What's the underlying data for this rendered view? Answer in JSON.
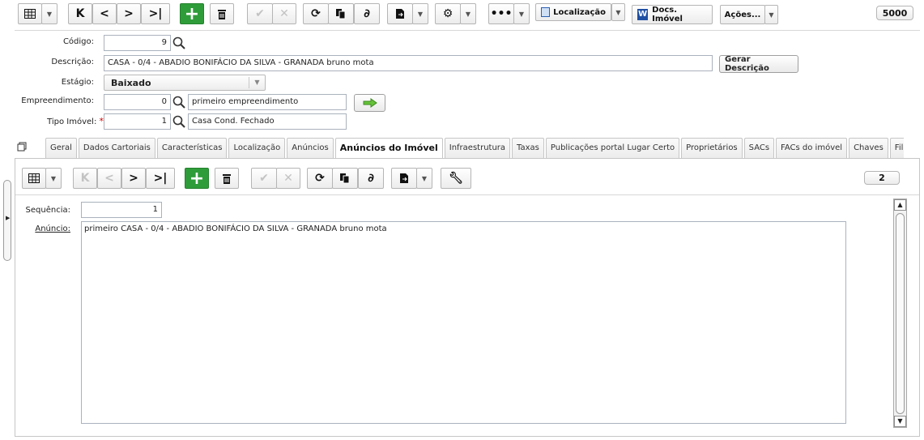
{
  "toolbar": {
    "localizacao_label": "Localização",
    "docs_label": "Docs. Imóvel",
    "acoes_label": "Ações...",
    "record_count": "5000"
  },
  "form": {
    "codigo_label": "Código:",
    "codigo_value": "9",
    "descricao_label": "Descrição:",
    "descricao_value": "CASA - 0/4 - ABADIO BONIFÁCIO DA SILVA - GRANADA bruno mota",
    "gerar_label": "Gerar Descrição",
    "estagio_label": "Estágio:",
    "estagio_value": "Baixado",
    "empreendimento_label": "Empreendimento:",
    "empreendimento_code": "0",
    "empreendimento_name": "primeiro empreendimento",
    "tipo_label": "Tipo Imóvel:",
    "tipo_required": "*",
    "tipo_code": "1",
    "tipo_name": "Casa Cond. Fechado"
  },
  "tabs": [
    {
      "label": "Geral"
    },
    {
      "label": "Dados Cartoriais"
    },
    {
      "label": "Características"
    },
    {
      "label": "Localização"
    },
    {
      "label": "Anúncios"
    },
    {
      "label": "Anúncios do Imóvel",
      "active": true
    },
    {
      "label": "Infraestrutura"
    },
    {
      "label": "Taxas"
    },
    {
      "label": "Publicações portal Lugar Certo"
    },
    {
      "label": "Proprietários"
    },
    {
      "label": "SACs"
    },
    {
      "label": "FACs do imóvel"
    },
    {
      "label": "Chaves"
    },
    {
      "label": "Fil"
    }
  ],
  "detail": {
    "record_count": "2",
    "sequencia_label": "Sequência:",
    "sequencia_value": "1",
    "anuncio_label": "Anúncio:",
    "anuncio_value": "primeiro CASA - 0/4 - ABADIO BONIFÁCIO DA SILVA - GRANADA bruno mota"
  },
  "icons": {
    "grid": "grid-icon",
    "first": "first-record-icon",
    "prev": "previous-icon",
    "next": "next-icon",
    "last": "last-record-icon",
    "new": "new-record-icon",
    "delete": "trash-icon",
    "save": "check-icon",
    "cancel": "cancel-icon",
    "refresh": "refresh-icon",
    "copy": "copy-icon",
    "attach": "paperclip-icon",
    "export": "export-icon",
    "settings": "gear-icon",
    "more": "more-icon",
    "tools": "wrench-icon",
    "search": "search-icon",
    "goto": "arrow-right-icon"
  },
  "colors": {
    "green": "#2f9c3a",
    "required": "#d10000",
    "docs_blue": "#1f4fa3"
  }
}
